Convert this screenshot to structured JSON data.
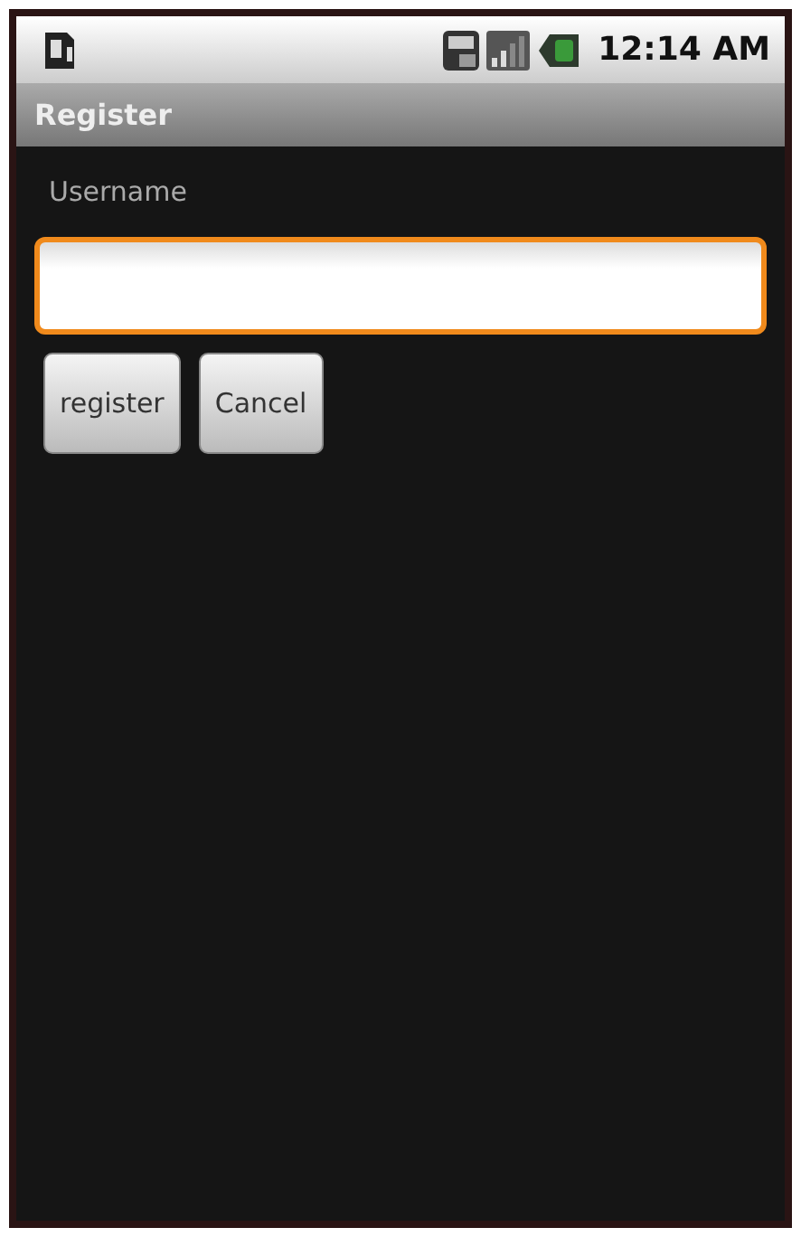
{
  "status_bar": {
    "time": "12:14 AM"
  },
  "title_bar": {
    "title": "Register"
  },
  "form": {
    "label": "Username",
    "field": {
      "focused": true
    },
    "buttons": [
      {
        "label": "register"
      },
      {
        "label": "Cancel"
      }
    ]
  }
}
